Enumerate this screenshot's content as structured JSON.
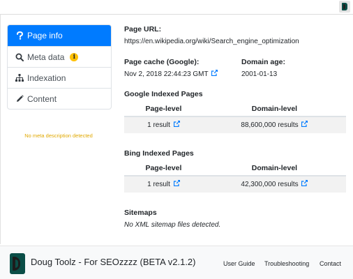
{
  "sidebar": {
    "items": [
      {
        "label": "Page info",
        "icon": "question-icon",
        "active": true
      },
      {
        "label": "Meta data",
        "icon": "search-icon",
        "badge": "i"
      },
      {
        "label": "Indexation",
        "icon": "sitemap-icon"
      },
      {
        "label": "Content",
        "icon": "pencil-icon"
      }
    ],
    "warning": "No meta description detected"
  },
  "main": {
    "page_url_label": "Page URL:",
    "page_url": "https://en.wikipedia.org/wiki/Search_engine_optimization",
    "cache_label": "Page cache (Google):",
    "cache_value": "Nov 2, 2018 22:44:23 GMT",
    "domain_age_label": "Domain age:",
    "domain_age_value": "2001-01-13",
    "google": {
      "title": "Google Indexed Pages",
      "col1": "Page-level",
      "col2": "Domain-level",
      "page_value": "1 result",
      "domain_value": "88,600,000 results"
    },
    "bing": {
      "title": "Bing Indexed Pages",
      "col1": "Page-level",
      "col2": "Domain-level",
      "page_value": "1 result",
      "domain_value": "42,300,000 results"
    },
    "sitemaps": {
      "title": "Sitemaps",
      "note": "No XML sitemap files detected."
    }
  },
  "footer": {
    "title": "Doug Toolz - For SEOzzzz (BETA v2.1.2)",
    "links": [
      "User Guide",
      "Troubleshooting",
      "Contact"
    ]
  },
  "colors": {
    "accent": "#007bff",
    "warning": "#ffc107",
    "brand": "#0b4e47"
  }
}
